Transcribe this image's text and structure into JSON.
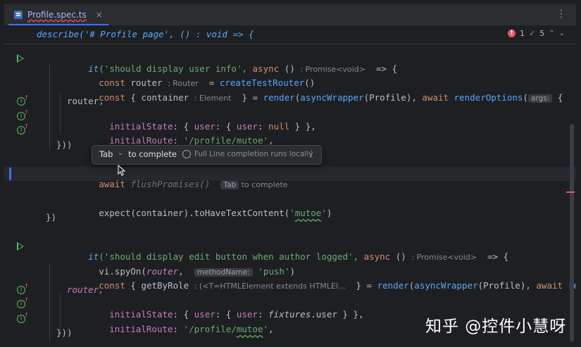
{
  "tab": {
    "title": "Profile.spec.ts",
    "close": "×"
  },
  "tab_menu": "⋮",
  "sticky": {
    "text": "describe('# Profile page', () : void  => {"
  },
  "inspection": {
    "errors": "1",
    "passed": "5",
    "up": "⌃",
    "down": "⌄"
  },
  "code": {
    "l1_kw": "it",
    "l1_a": "('should display user info', ",
    "l1_kw2": "async",
    "l1_b": " () ",
    "l1_hint": ": Promise<void>",
    "l1_c": "  => {",
    "l2_kw": "const",
    "l2_a": " router ",
    "l2_hint": ": Router",
    "l2_b": "  = ",
    "l2_fn": "createTestRouter",
    "l2_c": "()",
    "l3_kw": "const",
    "l3_a": " { container ",
    "l3_hint": ": Element",
    "l3_b": "  } = ",
    "l3_fn": "render",
    "l3_c": "(",
    "l3_fn2": "asyncWrapper",
    "l3_d": "(Profile), ",
    "l3_kw2": "await",
    "l3_e": " ",
    "l3_fn3": "renderOptions",
    "l3_f": "(",
    "l3_hint2": "args:",
    "l3_g": " {",
    "l4": "router,",
    "l5_a": "initialState",
    "l5_b": ": { ",
    "l5_c": "user",
    "l5_d": ": { ",
    "l5_e": "user",
    "l5_f": ": ",
    "l5_kw": "null",
    "l5_g": " } },",
    "l6_a": "initialRoute",
    "l6_b": ": ",
    "l6_str": "'/profile/",
    "l6_str2": "mutoe",
    "l6_str3": "'",
    "l6_c": ",",
    "l7": "}))",
    "l9_kw": "await",
    "l9_ghost": " flushPromises()",
    "l9_hint": "Tab",
    "l9_hint2": " to complete",
    "l11_a": "expect(container).toHaveTextContent(",
    "l11_str": "'",
    "l11_str2": "mutoe",
    "l11_str3": "'",
    "l11_b": ")",
    "l12": "})",
    "l14_kw": "it",
    "l14_a": "('should display edit button when author logged', ",
    "l14_kw2": "async",
    "l14_b": " () ",
    "l14_hint": ": Promise<void>",
    "l14_c": "  => {",
    "l15_a": "vi.spyOn(",
    "l15_it": "router",
    "l15_b": ",  ",
    "l15_hint": "methodName:",
    "l15_str": " 'push'",
    "l15_c": ")",
    "l16_kw": "const",
    "l16_a": " { getByRole ",
    "l16_hint": ": (<T=HTMLElement extends HTMLEl...",
    "l16_b": "  } = ",
    "l16_fn": "render",
    "l16_c": "(",
    "l16_fn2": "asyncWrapper",
    "l16_d": "(Profile), ",
    "l16_kw2": "await",
    "l16_e": " ",
    "l16_fn3": "renderOptions",
    "l17": "router,",
    "l18_a": "initialState",
    "l18_b": ": { ",
    "l18_c": "user",
    "l18_d": ": { ",
    "l18_e": "user",
    "l18_f": ": ",
    "l18_it": "fixtures",
    "l18_g": ".user } },",
    "l19_a": "initialRoute",
    "l19_b": ": ",
    "l19_str": "'/profile/",
    "l19_str2": "mutoe",
    "l19_str3": "'",
    "l19_c": ",",
    "l20": "}))"
  },
  "popup": {
    "key": "Tab",
    "chevron": "⌄",
    "action": "to complete",
    "info": "Full Line completion runs locally",
    "more": "⋮"
  },
  "watermark": "知乎 @控件小慧呀"
}
